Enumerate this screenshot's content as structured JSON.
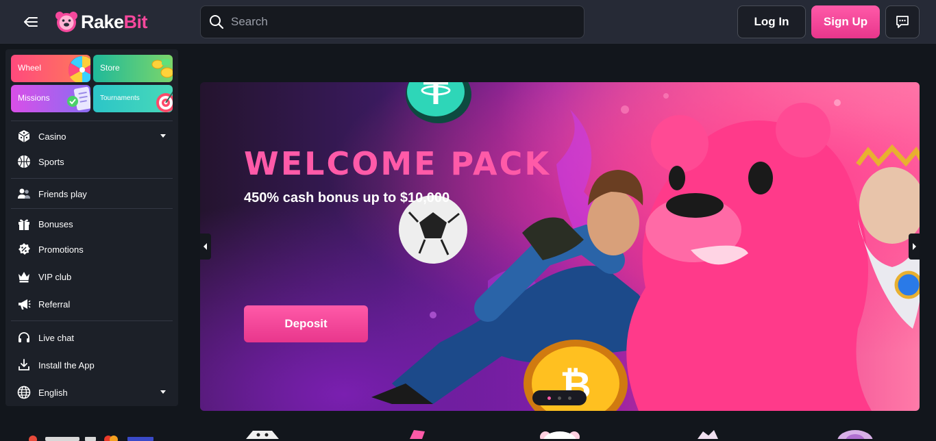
{
  "brand": {
    "name_part1": "Rake",
    "name_part2": "Bit",
    "accent": "#f5489c"
  },
  "header": {
    "menu_icon": "collapse-menu-icon",
    "search_placeholder": "Search",
    "login_label": "Log In",
    "signup_label": "Sign Up",
    "chat_icon": "chat-icon"
  },
  "sidebar": {
    "tiles": [
      {
        "label": "Wheel",
        "icon": "wheel-icon"
      },
      {
        "label": "Store",
        "icon": "coins-icon"
      },
      {
        "label": "Missions",
        "icon": "checklist-icon"
      },
      {
        "label": "Tournaments",
        "icon": "target-icon"
      }
    ],
    "items": [
      {
        "label": "Casino",
        "icon": "dice-icon",
        "has_dropdown": true
      },
      {
        "label": "Sports",
        "icon": "basketball-icon"
      },
      {
        "label": "Friends play",
        "icon": "friends-icon"
      },
      {
        "label": "Bonuses",
        "icon": "gift-icon"
      },
      {
        "label": "Promotions",
        "icon": "discount-tag-icon"
      },
      {
        "label": "VIP club",
        "icon": "crown-icon"
      },
      {
        "label": "Referral",
        "icon": "megaphone-icon"
      },
      {
        "label": "Live chat",
        "icon": "headset-icon"
      },
      {
        "label": "Install the App",
        "icon": "download-icon"
      },
      {
        "label": "English",
        "icon": "globe-icon",
        "has_dropdown": true
      }
    ]
  },
  "hero": {
    "title": "WELCOME PACK",
    "subtitle": "450% cash bonus up to $10,000",
    "cta": "Deposit",
    "slides_total": 3,
    "active_slide": 1
  }
}
